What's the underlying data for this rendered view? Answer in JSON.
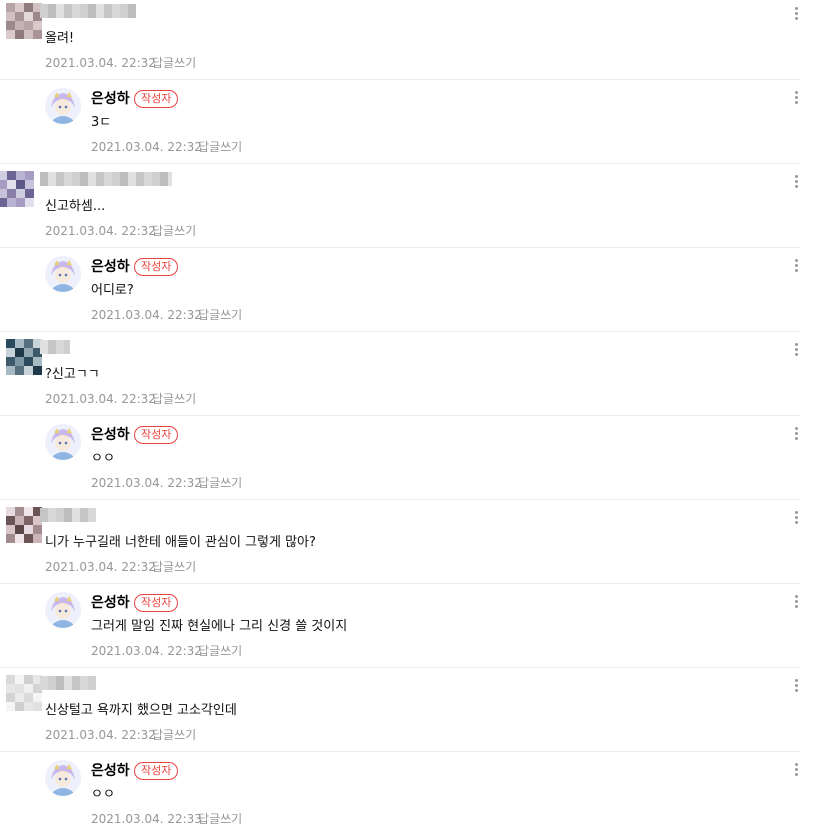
{
  "author_badge": "작성자",
  "reply_label": "답글쓰기",
  "comments": [
    {
      "type": "guest",
      "text": "올려!",
      "date": "2021.03.04. 22:32"
    },
    {
      "type": "author",
      "name": "은성하",
      "text": "3ㄷ",
      "date": "2021.03.04. 22:32"
    },
    {
      "type": "guest",
      "text": "신고하셈...",
      "date": "2021.03.04. 22:32"
    },
    {
      "type": "author",
      "name": "은성하",
      "text": "어디로?",
      "date": "2021.03.04. 22:32"
    },
    {
      "type": "guest",
      "text": "?신고ㄱㄱ",
      "date": "2021.03.04. 22:32"
    },
    {
      "type": "author",
      "name": "은성하",
      "text": "ㅇㅇ",
      "date": "2021.03.04. 22:32"
    },
    {
      "type": "guest",
      "text": "니가 누구길래 너한테 애들이 관심이 그렇게 많아?",
      "date": "2021.03.04. 22:32"
    },
    {
      "type": "author",
      "name": "은성하",
      "text": "그러게 말임 진짜 현실에나 그리 신경 쓸 것이지",
      "date": "2021.03.04. 22:32"
    },
    {
      "type": "guest",
      "text": "신상털고 욕까지 했으면 고소각인데",
      "date": "2021.03.04. 22:32"
    },
    {
      "type": "author",
      "name": "은성하",
      "text": "ㅇㅇ",
      "date": "2021.03.04. 22:33"
    }
  ]
}
